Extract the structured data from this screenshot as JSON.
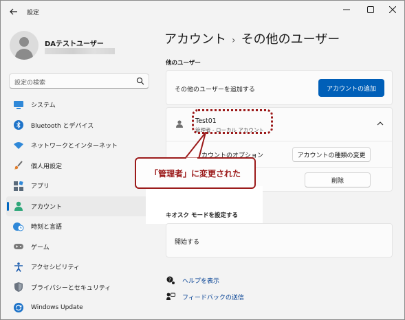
{
  "window": {
    "title": "設定",
    "minimize_glyph": "—",
    "maximize_glyph": "□",
    "close_glyph": "✕"
  },
  "user": {
    "name": "DAテストユーザー"
  },
  "search": {
    "placeholder": "設定の検索"
  },
  "sidebar": {
    "items": [
      {
        "label": "システム",
        "icon": "system-icon"
      },
      {
        "label": "Bluetooth とデバイス",
        "icon": "bluetooth-icon"
      },
      {
        "label": "ネットワークとインターネット",
        "icon": "wifi-icon"
      },
      {
        "label": "個人用設定",
        "icon": "brush-icon"
      },
      {
        "label": "アプリ",
        "icon": "apps-icon"
      },
      {
        "label": "アカウント",
        "icon": "account-icon",
        "active": true
      },
      {
        "label": "時刻と言語",
        "icon": "globe-clock-icon"
      },
      {
        "label": "ゲーム",
        "icon": "gamepad-icon"
      },
      {
        "label": "アクセシビリティ",
        "icon": "accessibility-icon"
      },
      {
        "label": "プライバシーとセキュリティ",
        "icon": "shield-icon"
      },
      {
        "label": "Windows Update",
        "icon": "update-icon"
      }
    ]
  },
  "main": {
    "breadcrumb_parent": "アカウント",
    "breadcrumb_sep": "›",
    "breadcrumb_current": "その他のユーザー",
    "other_users": {
      "heading": "他のユーザー",
      "add_label": "その他のユーザーを追加する",
      "add_button": "アカウントの追加"
    },
    "account": {
      "name": "Test01",
      "subtitle": "管理者 - ローカル アカウント",
      "options_label": "アカウントのオプション",
      "change_type_button": "アカウントの種類の変更",
      "delete_button": "削除"
    },
    "kiosk": {
      "heading": "キオスク モードを設定する",
      "start_label": "開始する"
    },
    "links": {
      "help": "ヘルプを表示",
      "feedback": "フィードバックの送信"
    }
  },
  "annotation": {
    "callout_text": "「管理者」に変更された",
    "color": "#9b1a1a"
  }
}
